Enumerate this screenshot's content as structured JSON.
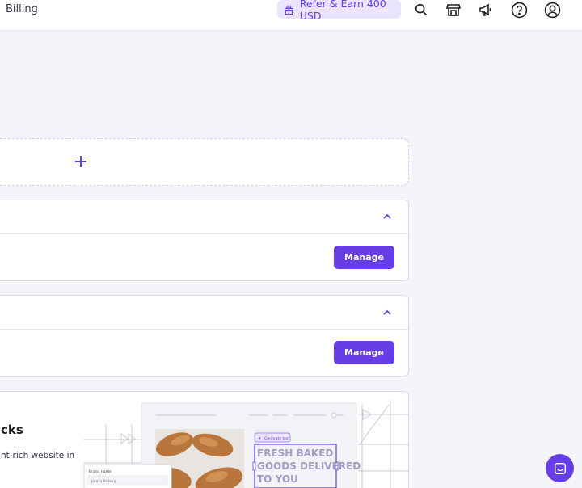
{
  "header": {
    "billing_label": "Billing",
    "refer_label": "Refer & Earn 400 USD",
    "icons": [
      "gift-icon",
      "search-icon",
      "store-icon",
      "megaphone-icon",
      "help-icon",
      "account-icon"
    ]
  },
  "services": [
    {
      "manage_label": "Manage"
    },
    {
      "manage_label": "Manage"
    }
  ],
  "promo": {
    "title": "cks",
    "description": "nt-rich website in",
    "mock_form_label": "Brand name",
    "mock_form_value": "John's Bakery",
    "mock_chip": "Generate text",
    "mock_headline_1": "FRESH BAKED",
    "mock_headline_2": "GOODS DELIVERED",
    "mock_headline_3": "TO YOU"
  },
  "colors": {
    "accent": "#673de6",
    "accent_light": "#ebe4ff",
    "background": "#f4f4fb"
  }
}
